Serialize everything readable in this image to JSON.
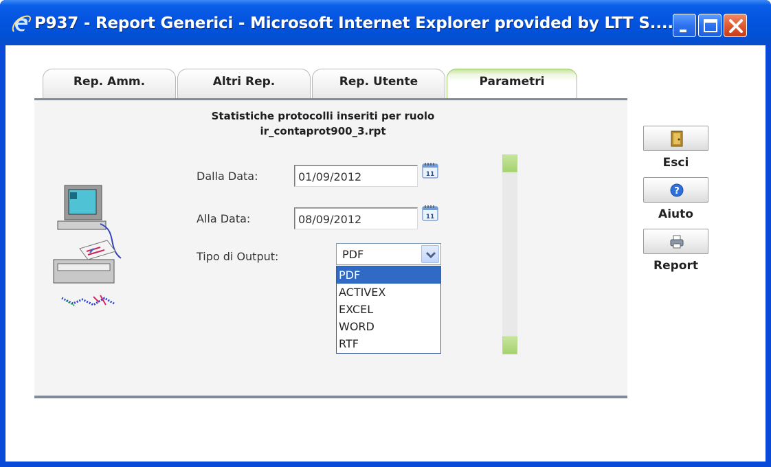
{
  "window": {
    "title": "P937 - Report Generici - Microsoft Internet Explorer provided by LTT S....",
    "icons": [
      "ie-logo-icon",
      "minimize-icon",
      "maximize-icon",
      "close-icon"
    ]
  },
  "tabs": [
    {
      "label": "Rep. Amm.",
      "active": false
    },
    {
      "label": "Altri Rep.",
      "active": false
    },
    {
      "label": "Rep. Utente",
      "active": false
    },
    {
      "label": "Parametri",
      "active": true
    }
  ],
  "report": {
    "description": "Statistiche protocolli inseriti per ruolo",
    "file": "ir_contaprot900_3.rpt"
  },
  "form": {
    "from_label": "Dalla Data:",
    "from_value": "01/09/2012",
    "to_label": "Alla Data:",
    "to_value": "08/09/2012",
    "output_label": "Tipo di Output:",
    "output_selected": "PDF",
    "output_options": [
      "PDF",
      "ACTIVEX",
      "EXCEL",
      "WORD",
      "RTF"
    ],
    "calendar_day": "11"
  },
  "side_buttons": [
    {
      "label": "Esci",
      "icon": "exit-door-icon"
    },
    {
      "label": "Aiuto",
      "icon": "help-icon"
    },
    {
      "label": "Report",
      "icon": "printer-icon"
    }
  ],
  "colors": {
    "titlebar": "#0454e0",
    "tab_active_accent": "#c6e59a",
    "selection": "#316ac5",
    "scroll_button": "#a6d26e"
  }
}
